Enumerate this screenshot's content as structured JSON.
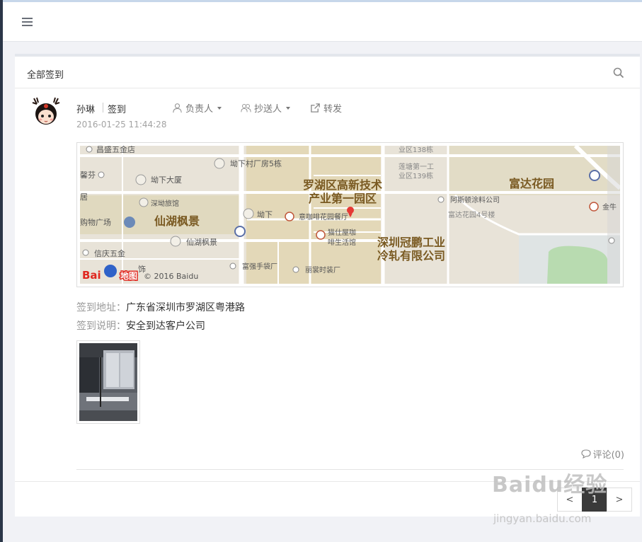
{
  "header": {
    "menu_icon": "hamburger-menu-icon"
  },
  "panel": {
    "title": "全部签到",
    "search_icon": "search-icon"
  },
  "record": {
    "user_name": "孙琳",
    "type": "签到",
    "actions": [
      {
        "label": "负责人",
        "icon": "user-icon",
        "dropdown": true
      },
      {
        "label": "抄送人",
        "icon": "users-icon",
        "dropdown": true
      },
      {
        "label": "转发",
        "icon": "share-icon",
        "dropdown": false
      }
    ],
    "time": "2016-01-25 11:44:28",
    "address_label": "签到地址：",
    "address": "广东省深圳市罗湖区粤港路",
    "note_label": "签到说明：",
    "note": "安全到达客户公司",
    "comment": "评论(0)"
  },
  "map": {
    "labels": {
      "l1": "昌盛五金店",
      "l2": "坳下村厂房5栋",
      "l3": "业区138栋",
      "l4": "莲塘第一工",
      "l5": "业区139栋",
      "l6": "富达花园",
      "l7": "罗湖区高新技术",
      "l8": "产业第一园区",
      "l9": "坳下大厦",
      "l10": "深坳旅馆",
      "l11": "阿斯顿涂料公司",
      "l12": "富达花园4号楼",
      "l13": "仙湖枫景",
      "l14": "坳下",
      "l15": "意咖啡花园餐厅",
      "l16": "购物广场",
      "l17": "猫仕屋咖",
      "l18": "啡生活馆",
      "l19": "深圳冠鹏工业",
      "l20": "冷轧有限公司",
      "l21": "仙湖枫景",
      "l22": "信庆五金",
      "l23": "富强手袋厂",
      "l24": "丽裳时装厂",
      "l25": "© 2016 Baidu",
      "l26": "金牛",
      "l27": "馨芬",
      "l28": "居",
      "l29": "Bai",
      "l30": "地图",
      "l31": "饰"
    }
  },
  "pagination": {
    "prev": "<",
    "current": "1",
    "next": ">"
  },
  "watermark": {
    "text": "Baidu经验",
    "url": "jingyan.baidu.com"
  },
  "colors": {
    "map_bg": "#e8e3d8",
    "road": "#ffffff",
    "accent_brown": "#7a5a22",
    "pin": "#e53935"
  }
}
